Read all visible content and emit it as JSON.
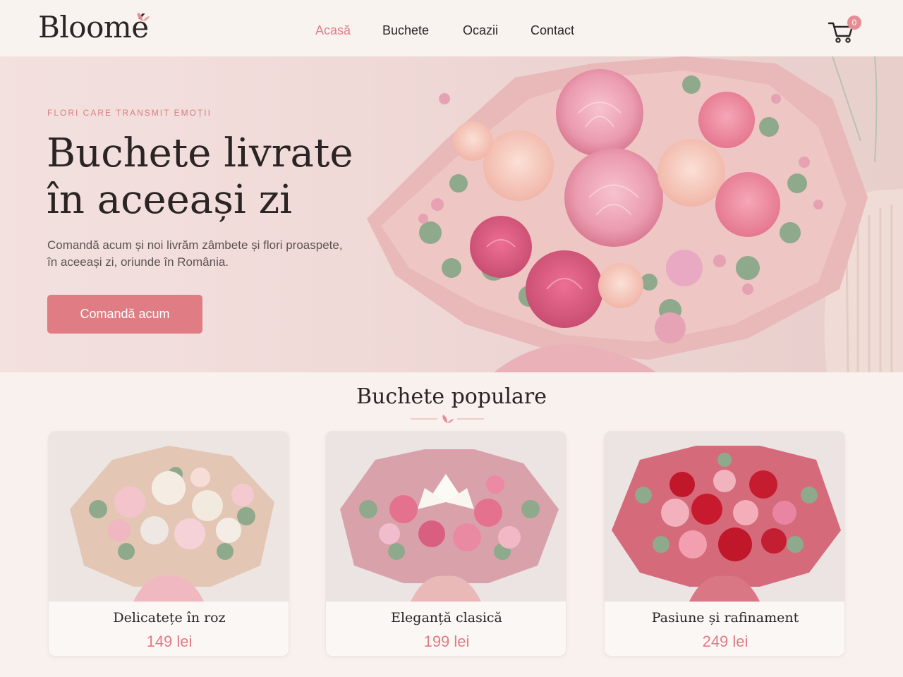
{
  "header": {
    "logo": "Bloomé",
    "nav": [
      {
        "label": "Acasă",
        "active": true
      },
      {
        "label": "Buchete",
        "active": false
      },
      {
        "label": "Ocazii",
        "active": false
      },
      {
        "label": "Contact",
        "active": false
      }
    ],
    "cart_count": "0",
    "cart_icon": "shopping-cart-icon"
  },
  "hero": {
    "eyebrow": "FLORI CARE TRANSMIT EMOȚII",
    "title_line1": "Buchete livrate",
    "title_line2": "în aceeași zi",
    "subtitle": "Comandă acum și noi livrăm zâmbete și flori proaspete, în aceeași zi, oriunde în România.",
    "cta": "Comandă acum"
  },
  "popular": {
    "title": "Buchete populare",
    "products": [
      {
        "name": "Delicatețe în roz",
        "price": "149 lei"
      },
      {
        "name": "Eleganță clasică",
        "price": "199 lei"
      },
      {
        "name": "Pasiune și rafinament",
        "price": "249 lei"
      }
    ]
  },
  "colors": {
    "accent": "#df7c84",
    "background": "#f8f1ee",
    "text": "#2a2424"
  }
}
